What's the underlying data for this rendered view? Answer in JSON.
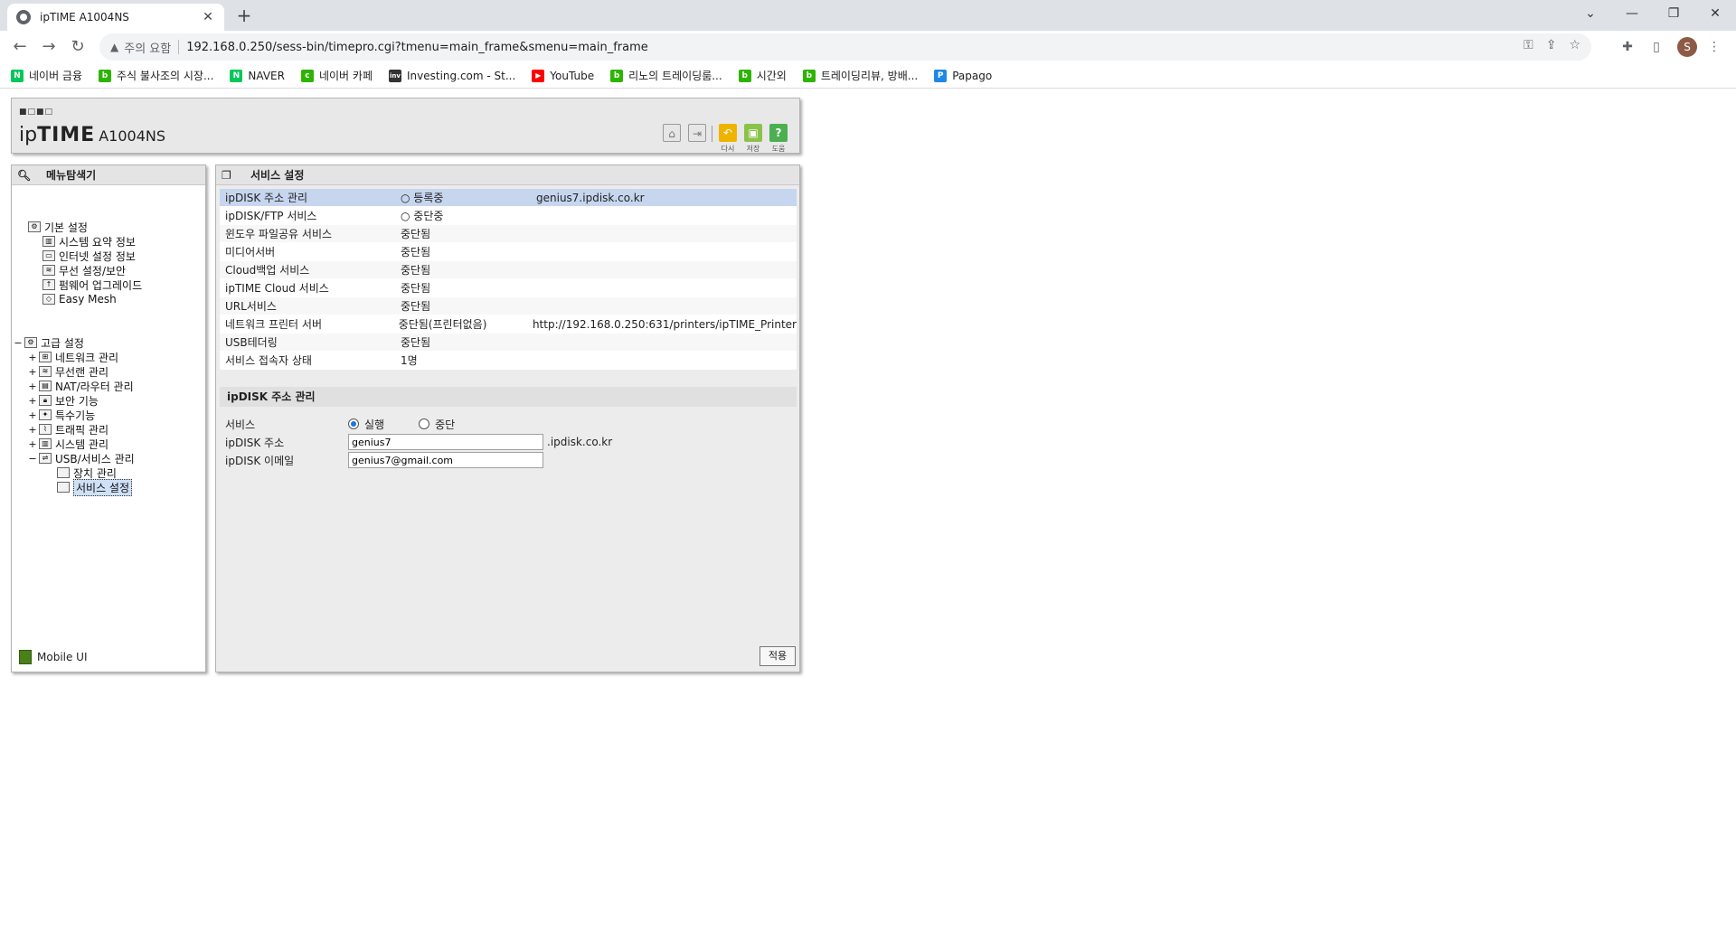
{
  "browser": {
    "tab_title": "ipTIME A1004NS",
    "security_label": "주의 요함",
    "url": "192.168.0.250/sess-bin/timepro.cgi?tmenu=main_frame&smenu=main_frame",
    "profile_initial": "S",
    "bookmarks": [
      {
        "label": "네이버 금융",
        "color": "#03c75a",
        "glyph": "N"
      },
      {
        "label": "주식 불사조의 시장...",
        "color": "#2db400",
        "glyph": "b"
      },
      {
        "label": "NAVER",
        "color": "#03c75a",
        "glyph": "N"
      },
      {
        "label": "네이버 카페",
        "color": "#2db400",
        "glyph": "c"
      },
      {
        "label": "Investing.com - St...",
        "color": "#333333",
        "glyph": "inv"
      },
      {
        "label": "YouTube",
        "color": "#ff0000",
        "glyph": "▶"
      },
      {
        "label": "리노의 트레이딩룸...",
        "color": "#2db400",
        "glyph": "b"
      },
      {
        "label": "시간외",
        "color": "#2db400",
        "glyph": "b"
      },
      {
        "label": "트레이딩리뷰, 방배...",
        "color": "#2db400",
        "glyph": "b"
      },
      {
        "label": "Papago",
        "color": "#1e88e5",
        "glyph": "P"
      }
    ]
  },
  "header": {
    "logo_prefix": "ip",
    "logo_bold": "TIME",
    "model": "A1004NS",
    "icons": [
      {
        "label": "",
        "glyph": "⌂",
        "color": "#e6e6e6"
      },
      {
        "label": "",
        "glyph": "⇥",
        "color": "#e6e6e6"
      },
      {
        "label": "다시",
        "glyph": "↶",
        "color": "#f0b400"
      },
      {
        "label": "저장",
        "glyph": "▣",
        "color": "#8bc34a"
      },
      {
        "label": "도움",
        "glyph": "?",
        "color": "#4caf50"
      }
    ]
  },
  "sidebar": {
    "title": "메뉴탐색기",
    "items": [
      {
        "label": "기본 설정",
        "toggle": ""
      },
      {
        "label": "시스템 요약 정보",
        "toggle": ""
      },
      {
        "label": "인터넷 설정 정보",
        "toggle": ""
      },
      {
        "label": "무선 설정/보안",
        "toggle": ""
      },
      {
        "label": "펌웨어 업그레이드",
        "toggle": ""
      },
      {
        "label": "Easy Mesh",
        "toggle": ""
      },
      {
        "label": "고급 설정",
        "toggle": "−"
      },
      {
        "label": "네트워크 관리",
        "toggle": "+"
      },
      {
        "label": "무선랜 관리",
        "toggle": "+"
      },
      {
        "label": "NAT/라우터 관리",
        "toggle": "+"
      },
      {
        "label": "보안 기능",
        "toggle": "+"
      },
      {
        "label": "특수기능",
        "toggle": "+"
      },
      {
        "label": "트래픽 관리",
        "toggle": "+"
      },
      {
        "label": "시스템 관리",
        "toggle": "+"
      },
      {
        "label": "USB/서비스 관리",
        "toggle": "−"
      },
      {
        "label": "장치 관리",
        "toggle": ""
      },
      {
        "label": "서비스 설정",
        "toggle": ""
      }
    ],
    "mobile_label": "Mobile UI"
  },
  "main": {
    "title": "서비스 설정",
    "services": [
      {
        "name": "ipDISK 주소 관리",
        "status": "○ 등록중",
        "detail": "genius7.ipdisk.co.kr"
      },
      {
        "name": "ipDISK/FTP 서비스",
        "status": "○ 중단중",
        "detail": ""
      },
      {
        "name": "윈도우 파일공유 서비스",
        "status": "중단됨",
        "detail": ""
      },
      {
        "name": "미디어서버",
        "status": "중단됨",
        "detail": ""
      },
      {
        "name": "Cloud백업 서비스",
        "status": "중단됨",
        "detail": ""
      },
      {
        "name": "ipTIME Cloud 서비스",
        "status": "중단됨",
        "detail": ""
      },
      {
        "name": "URL서비스",
        "status": "중단됨",
        "detail": ""
      },
      {
        "name": "네트워크 프린터 서버",
        "status": "중단됨(프린터없음)",
        "detail": "http://192.168.0.250:631/printers/ipTIME_Printer"
      },
      {
        "name": "USB테더링",
        "status": "중단됨",
        "detail": ""
      },
      {
        "name": "서비스 접속자 상태",
        "status": "1명",
        "detail": ""
      }
    ],
    "section_title": "ipDISK 주소 관리",
    "form": {
      "service_label": "서비스",
      "run_label": "실행",
      "stop_label": "중단",
      "address_label": "ipDISK 주소",
      "address_value": "genius7",
      "address_suffix": ".ipdisk.co.kr",
      "email_label": "ipDISK 이메일",
      "email_value": "genius7@gmail.com"
    },
    "apply_label": "적용"
  }
}
